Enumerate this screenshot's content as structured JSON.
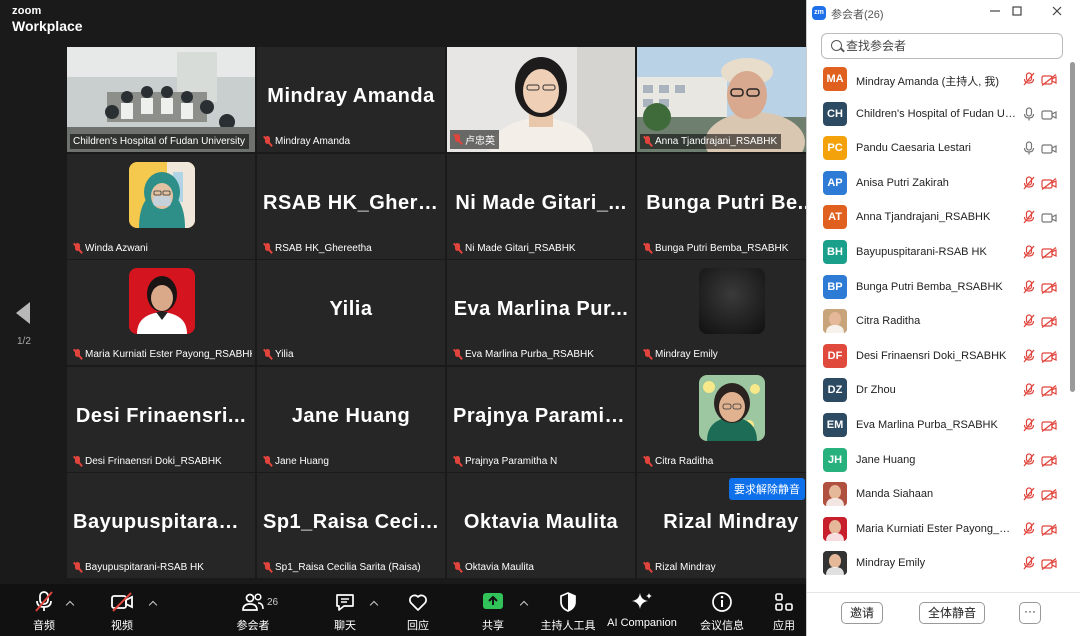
{
  "app": {
    "logo_top": "zoom",
    "logo_bottom": "Workplace",
    "page_indicator": "1/2"
  },
  "tiles": [
    {
      "name": "Children's Hospital of Fudan University",
      "kind": "video-room",
      "muted": false,
      "active": true
    },
    {
      "name": "Mindray Amanda",
      "display": "Mindray Amanda",
      "kind": "name",
      "muted": true
    },
    {
      "name": "卢忠英",
      "kind": "video-woman",
      "muted": true
    },
    {
      "name": "Anna Tjandrajani_RSABHK",
      "kind": "video-outdoor",
      "muted": true
    },
    {
      "name": "Winda Azwani",
      "kind": "avatar-hijab",
      "muted": true
    },
    {
      "name": "RSAB HK_Ghereetha",
      "display": "RSAB HK_Ghere...",
      "kind": "name",
      "muted": true
    },
    {
      "name": "Ni Made Gitari_RSABHK",
      "display": "Ni Made Gitari_...",
      "kind": "name",
      "muted": true
    },
    {
      "name": "Bunga Putri Bemba_RSABHK",
      "display": "Bunga Putri Be...",
      "kind": "name",
      "muted": true
    },
    {
      "name": "Maria Kurniati Ester Payong_RSABHK",
      "kind": "avatar-red",
      "muted": true
    },
    {
      "name": "Yilia",
      "display": "Yilia",
      "kind": "name",
      "muted": true
    },
    {
      "name": "Eva Marlina Purba_RSABHK",
      "display": "Eva Marlina Pur...",
      "kind": "name",
      "muted": true
    },
    {
      "name": "Mindray Emily",
      "kind": "avatar-dark",
      "muted": true
    },
    {
      "name": "Desi Frinaensri Doki_RSABHK",
      "display": "Desi Frinaensri...",
      "kind": "name",
      "muted": true
    },
    {
      "name": "Jane Huang",
      "display": "Jane Huang",
      "kind": "name",
      "muted": true
    },
    {
      "name": "Prajnya Paramitha N",
      "display": "Prajnya Paramit...",
      "kind": "name",
      "muted": true
    },
    {
      "name": "Citra Raditha",
      "kind": "avatar-citra",
      "muted": true
    },
    {
      "name": "Bayupuspitarani-RSAB HK",
      "display": "Bayupuspitarani...",
      "kind": "name",
      "muted": true
    },
    {
      "name": "Sp1_Raisa Cecilia Sarita (Raisa)",
      "display": "Sp1_Raisa Cecili...",
      "kind": "name",
      "muted": true
    },
    {
      "name": "Oktavia Maulita",
      "display": "Oktavia Maulita",
      "kind": "name",
      "muted": true
    },
    {
      "name": "Rizal Mindray",
      "display": "Rizal Mindray",
      "kind": "name",
      "muted": true
    }
  ],
  "unmute_request": "要求解除静音",
  "toolbar": {
    "audio": "音频",
    "video": "视频",
    "participants": "参会者",
    "participants_count": "26",
    "chat": "聊天",
    "react": "回应",
    "share": "共享",
    "host_tools": "主持人工具",
    "ai_companion": "AI Companion",
    "meeting_info": "会议信息",
    "apps": "应用"
  },
  "panel": {
    "title": "参会者(26)",
    "search_placeholder": "查找参会者",
    "participants": [
      {
        "initials": "MA",
        "name": "Mindray Amanda (主持人, 我)",
        "color": "#e0611f",
        "mic": "off",
        "cam": "off"
      },
      {
        "initials": "CH",
        "name": "Children's Hospital of Fudan University",
        "color": "#2d4a63",
        "mic": "on",
        "cam": "on"
      },
      {
        "initials": "PC",
        "name": "Pandu Caesaria Lestari",
        "color": "#f4a20c",
        "mic": "on",
        "cam": "on"
      },
      {
        "initials": "AP",
        "name": "Anisa Putri Zakirah",
        "color": "#2e7bd6",
        "mic": "off",
        "cam": "off"
      },
      {
        "initials": "AT",
        "name": "Anna Tjandrajani_RSABHK",
        "color": "#e0611f",
        "mic": "off",
        "cam": "on"
      },
      {
        "initials": "BH",
        "name": "Bayupuspitarani-RSAB HK",
        "color": "#1aa08a",
        "mic": "off",
        "cam": "off"
      },
      {
        "initials": "BP",
        "name": "Bunga Putri Bemba_RSABHK",
        "color": "#2e7bd6",
        "mic": "off",
        "cam": "off"
      },
      {
        "initials": "",
        "name": "Citra Raditha",
        "color": "#c8a47a",
        "mic": "off",
        "cam": "off"
      },
      {
        "initials": "DF",
        "name": "Desi Frinaensri Doki_RSABHK",
        "color": "#e04a3c",
        "mic": "off",
        "cam": "off"
      },
      {
        "initials": "DZ",
        "name": "Dr Zhou",
        "color": "#2d4a63",
        "mic": "off",
        "cam": "off"
      },
      {
        "initials": "EM",
        "name": "Eva Marlina Purba_RSABHK",
        "color": "#2d4a63",
        "mic": "off",
        "cam": "off"
      },
      {
        "initials": "JH",
        "name": "Jane Huang",
        "color": "#27b27d",
        "mic": "off",
        "cam": "off"
      },
      {
        "initials": "",
        "name": "Manda Siahaan",
        "color": "#b0503e",
        "mic": "off",
        "cam": "off"
      },
      {
        "initials": "",
        "name": "Maria Kurniati Ester Payong_RSABHK",
        "color": "#c7202c",
        "mic": "off",
        "cam": "off"
      },
      {
        "initials": "",
        "name": "Mindray Emily",
        "color": "#333333",
        "mic": "off",
        "cam": "off"
      }
    ],
    "invite": "邀请",
    "mute_all": "全体静音",
    "more": "···"
  }
}
